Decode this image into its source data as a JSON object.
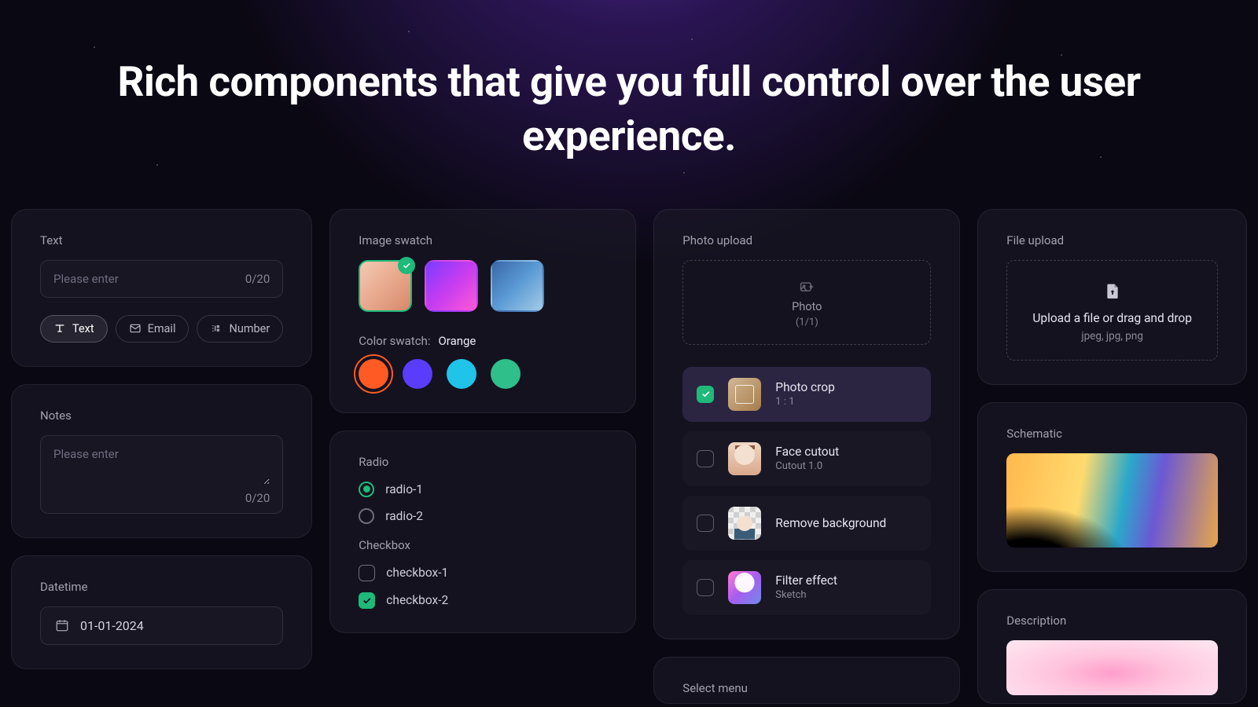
{
  "headline": "Rich components that give you full control over the user experience.",
  "text_card": {
    "label": "Text",
    "placeholder": "Please enter",
    "counter": "0/20",
    "pills": [
      {
        "icon": "text",
        "label": "Text",
        "active": true
      },
      {
        "icon": "mail",
        "label": "Email",
        "active": false
      },
      {
        "icon": "number",
        "label": "Number",
        "active": false
      }
    ]
  },
  "notes_card": {
    "label": "Notes",
    "placeholder": "Please enter",
    "counter": "0/20"
  },
  "datetime_card": {
    "label": "Datetime",
    "value": "01-01-2024"
  },
  "swatch_card": {
    "label": "Image swatch",
    "color_label": "Color swatch:",
    "color_value": "Orange",
    "colors": [
      "#ff5a24",
      "#5a3cff",
      "#1fc4e8",
      "#2fbf8a"
    ],
    "selected_color_index": 0
  },
  "radio_card": {
    "radio_label": "Radio",
    "radios": [
      {
        "label": "radio-1",
        "checked": true
      },
      {
        "label": "radio-2",
        "checked": false
      }
    ],
    "checkbox_label": "Checkbox",
    "checkboxes": [
      {
        "label": "checkbox-1",
        "checked": false
      },
      {
        "label": "checkbox-2",
        "checked": true
      }
    ]
  },
  "photo_card": {
    "label": "Photo upload",
    "drop_label": "Photo",
    "drop_sub": "(1/1)",
    "options": [
      {
        "title": "Photo crop",
        "sub": "1 : 1",
        "checked": true
      },
      {
        "title": "Face cutout",
        "sub": "Cutout 1.0",
        "checked": false
      },
      {
        "title": "Remove background",
        "sub": "",
        "checked": false
      },
      {
        "title": "Filter effect",
        "sub": "Sketch",
        "checked": false
      }
    ]
  },
  "select_card": {
    "label": "Select menu"
  },
  "file_card": {
    "label": "File upload",
    "big": "Upload a file or drag and drop",
    "small": "jpeg, jpg, png"
  },
  "schematic_card": {
    "label": "Schematic"
  },
  "description_card": {
    "label": "Description"
  }
}
